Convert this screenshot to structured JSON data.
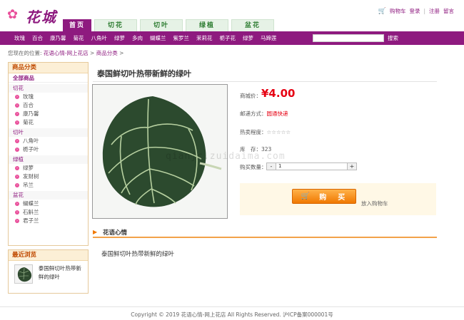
{
  "header": {
    "logo_text": "花城",
    "top_links": {
      "cart": "购物车",
      "login": "登录",
      "register": "注册",
      "message": "留言",
      "separator": "|"
    }
  },
  "main_tabs": [
    "首页",
    "切花",
    "切叶",
    "绿植",
    "盆花"
  ],
  "category_bar": {
    "items": [
      "玫瑰",
      "百合",
      "康乃馨",
      "菊花",
      "八角叶",
      "绿萝",
      "多肉",
      "蝴蝶兰",
      "紫罗兰",
      "茉莉花",
      "栀子花",
      "绿萝",
      "马蹄莲"
    ],
    "search_placeholder": "",
    "search_label": "搜索"
  },
  "breadcrumb": {
    "prefix": "您现在的位置:",
    "home": "花语心情-网上花店",
    "sep": ">",
    "category": "商品分类"
  },
  "sidebar": {
    "title": "商品分类",
    "all": "全部商品",
    "groups": [
      {
        "name": "切花",
        "items": [
          "玫瑰",
          "百合",
          "康乃馨",
          "菊花"
        ]
      },
      {
        "name": "切叶",
        "items": [
          "八角叶",
          "栀子叶"
        ]
      },
      {
        "name": "绿植",
        "items": [
          "绿萝",
          "发财树",
          "吊兰"
        ]
      },
      {
        "name": "盆花",
        "items": [
          "蝴蝶兰",
          "石斛兰",
          "君子兰"
        ]
      }
    ],
    "recent_title": "最近浏览",
    "recent_item": "泰国鲜切叶热带新鲜的绿叶"
  },
  "product": {
    "title": "泰国鲜切叶热带新鲜的绿叶",
    "price_label": "商城价：",
    "price": "¥4.00",
    "shipping_label": "邮递方式：",
    "shipping_value": "圆通快递",
    "rating_label": "热卖程度：",
    "rating_stars": "☆☆☆☆☆",
    "stock_label": "库　存：",
    "stock_value": "323",
    "qty_label": "购买数量：",
    "qty_minus": "-",
    "qty_value": "1",
    "qty_plus": "+",
    "buy_label": "购　买",
    "add_cart": "放入购物车"
  },
  "section": {
    "title": "花语心情",
    "body": "泰国鲜切叶热带新鲜的绿叶"
  },
  "watermark": "qianjc.zuidaima.com",
  "footer": "Copyright © 2019 花语心情-网上花店 All Rights Reserved. 沪ICP备案000001号",
  "colors": {
    "brand": "#8e1a7f",
    "price": "#e60012",
    "button": "#f07800"
  }
}
